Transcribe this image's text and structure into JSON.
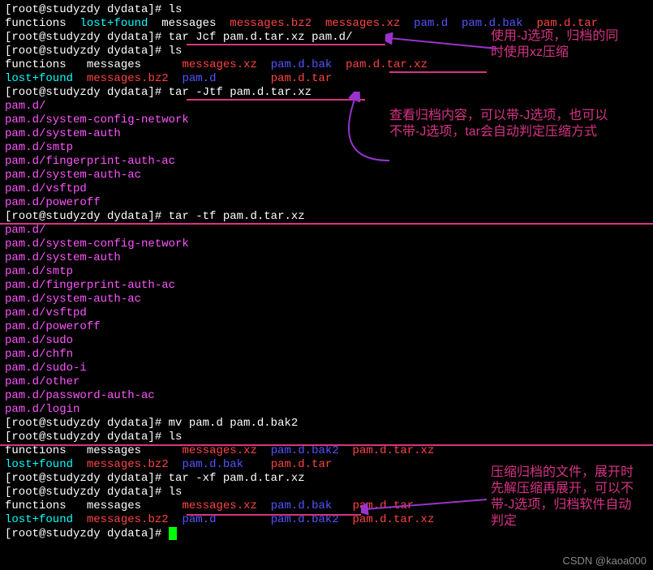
{
  "prompt": "[root@studyzdy dydata]# ",
  "cmd": {
    "ls1": "ls",
    "tarJcf": "tar Jcf pam.d.tar.xz pam.d/",
    "ls2": "ls",
    "tarJtf": "tar -Jtf pam.d.tar.xz",
    "tartf": "tar -tf pam.d.tar.xz",
    "mv": "mv pam.d pam.d.bak2",
    "ls3": "ls",
    "tarxf": "tar -xf pam.d.tar.xz",
    "ls4": "ls"
  },
  "ls_out1": {
    "functions": "functions",
    "lostfound": "lost+found",
    "messages": "messages",
    "messagesbz2": "messages.bz2",
    "messagesxz": "messages.xz",
    "pamd": "pam.d",
    "pamdbak": "pam.d.bak",
    "pamdtar": "pam.d.tar"
  },
  "ls_out2": {
    "functions": "functions",
    "messages": "messages",
    "messagesxz": "messages.xz",
    "pamdbak": "pam.d.bak",
    "pamdtarxz": "pam.d.tar.xz",
    "lostfound": "lost+found",
    "messagesbz2": "messages.bz2",
    "pamd": "pam.d",
    "pamdtar": "pam.d.tar"
  },
  "listing1": [
    "pam.d/",
    "pam.d/system-config-network",
    "pam.d/system-auth",
    "pam.d/smtp",
    "pam.d/fingerprint-auth-ac",
    "pam.d/system-auth-ac",
    "pam.d/vsftpd",
    "pam.d/poweroff"
  ],
  "listing2": [
    "pam.d/",
    "pam.d/system-config-network",
    "pam.d/system-auth",
    "pam.d/smtp",
    "pam.d/fingerprint-auth-ac",
    "pam.d/system-auth-ac",
    "pam.d/vsftpd",
    "pam.d/poweroff",
    "pam.d/sudo",
    "pam.d/chfn",
    "pam.d/sudo-i",
    "pam.d/other",
    "pam.d/password-auth-ac",
    "pam.d/login"
  ],
  "ls_out3": {
    "functions": "functions",
    "messages": "messages",
    "messagesxz": "messages.xz",
    "pamdbak2": "pam.d.bak2",
    "pamdtarxz": "pam.d.tar.xz",
    "lostfound": "lost+found",
    "messagesbz2": "messages.bz2",
    "pamdbak": "pam.d.bak",
    "pamdtar": "pam.d.tar"
  },
  "ls_out4": {
    "functions": "functions",
    "messages": "messages",
    "messagesxz": "messages.xz",
    "pamdbak": "pam.d.bak",
    "pamdtar": "pam.d.tar",
    "lostfound": "lost+found",
    "messagesbz2": "messages.bz2",
    "pamd": "pam.d",
    "pamdbak2": "pam.d.bak2",
    "pamdtarxz": "pam.d.tar.xz"
  },
  "annotations": {
    "a1": "使用-J选项，归档的同时使用xz压缩",
    "a2": "查看归档内容，可以带-J选项，也可以不带-J选项，tar会自动判定压缩方式",
    "a3": "压缩归档的文件，展开时先解压缩再展开，可以不带-J选项，归档软件自动判定"
  },
  "watermark": "CSDN @kaoa000"
}
